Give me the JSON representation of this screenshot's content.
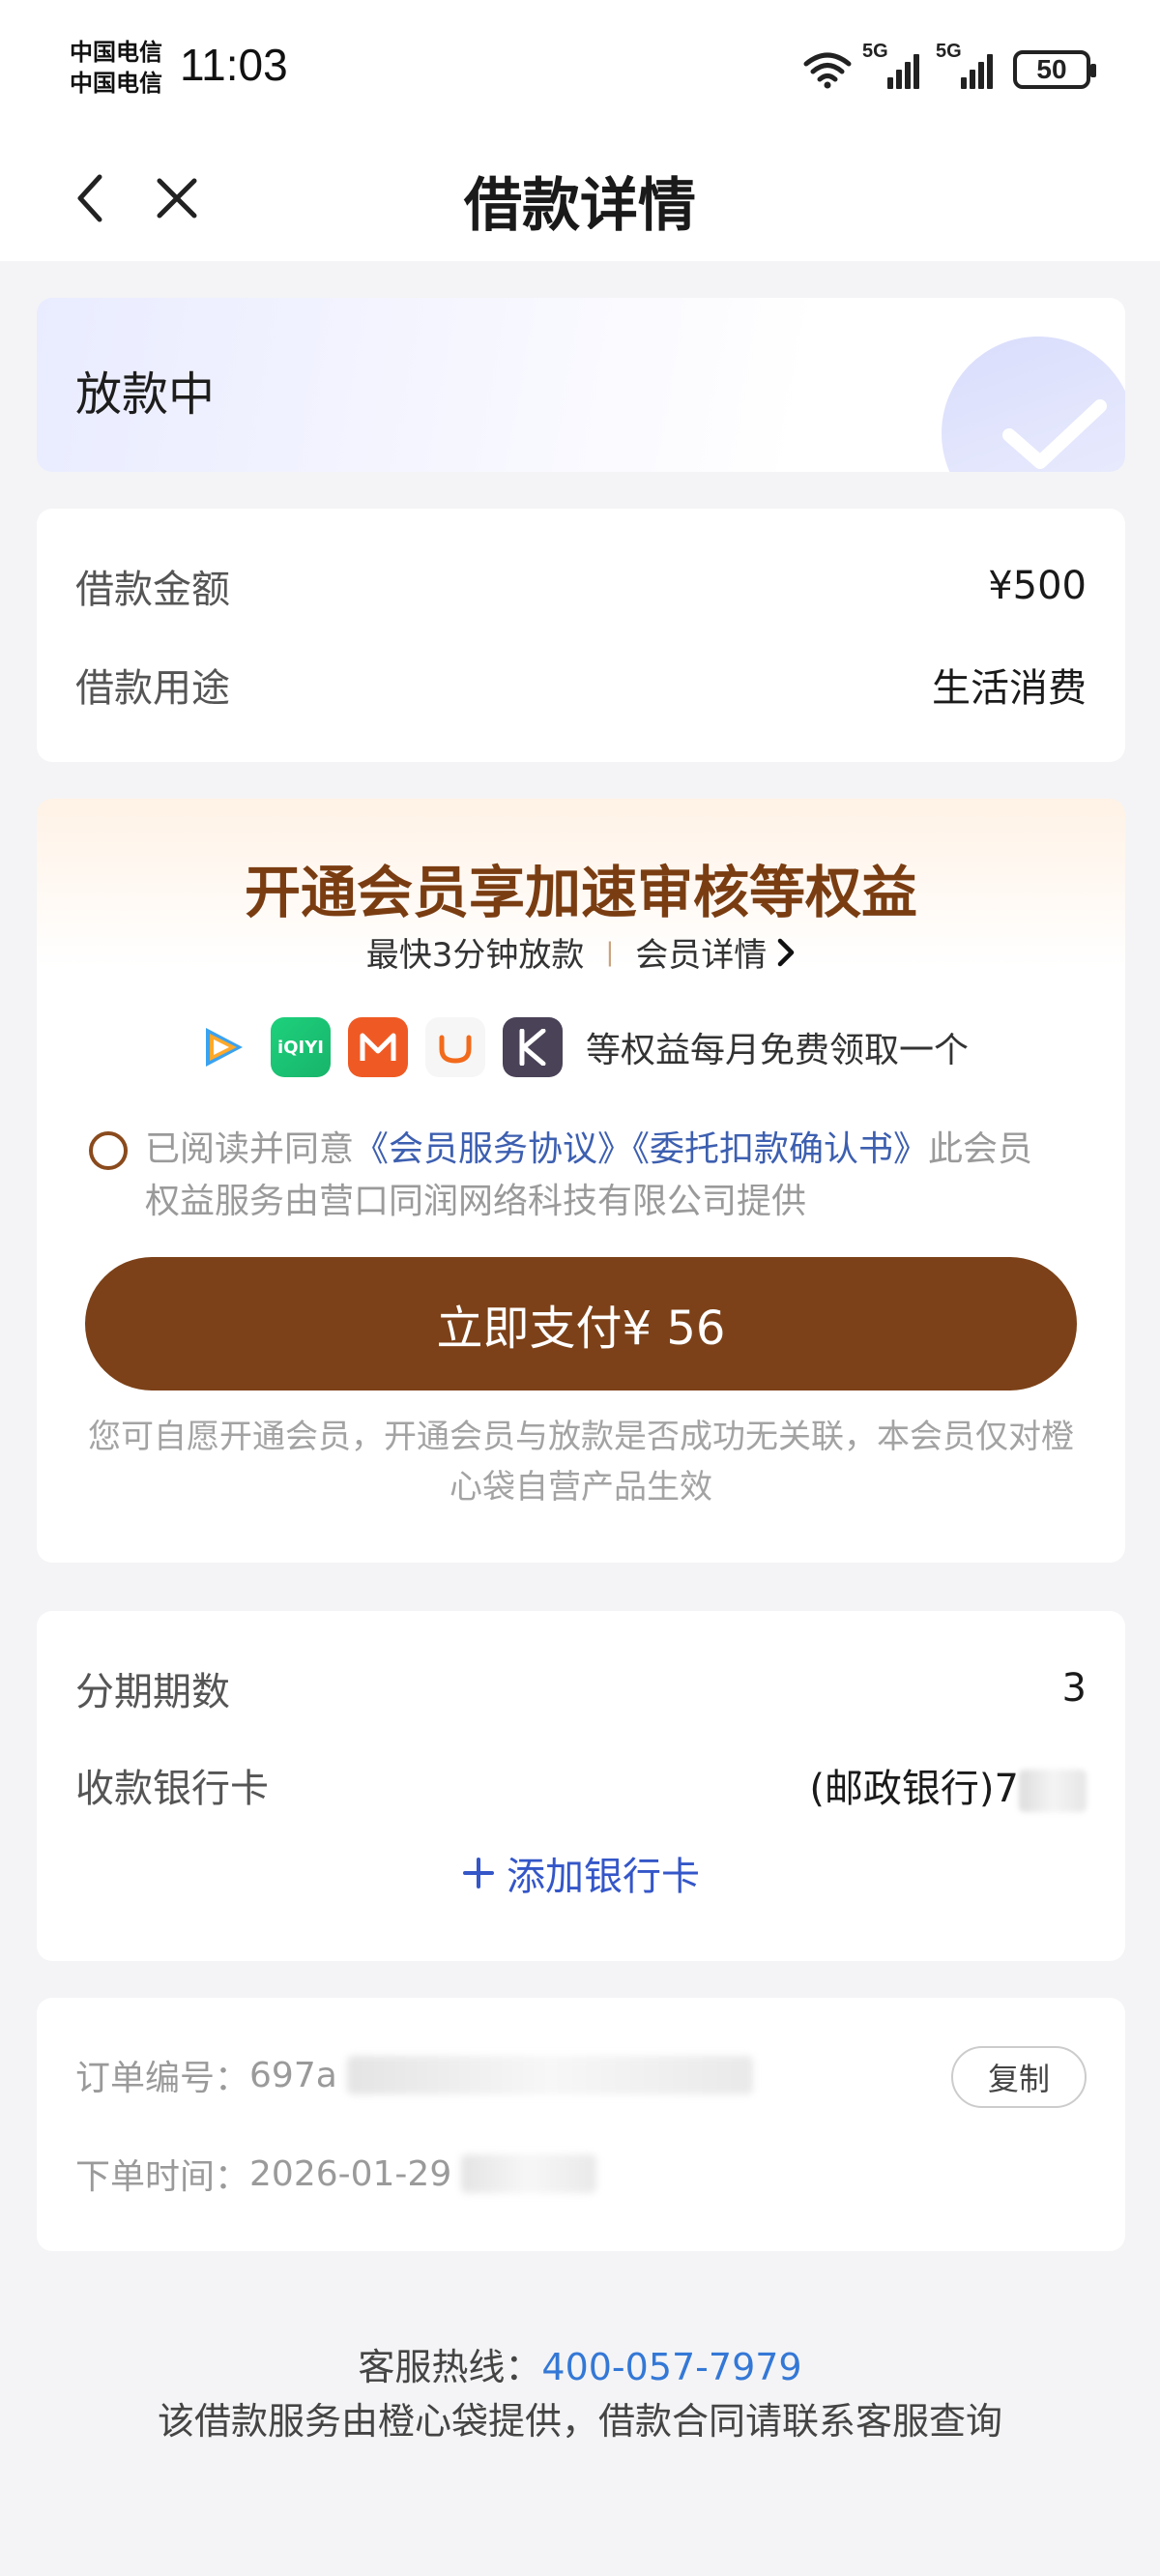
{
  "status_bar": {
    "carrier_1": "中国电信",
    "carrier_2": "中国电信",
    "time": "11:03",
    "network_1": "5G",
    "network_2": "5G",
    "battery": "50"
  },
  "header": {
    "title": "借款详情",
    "back_icon": "chevron-left-icon",
    "close_icon": "close-icon"
  },
  "status": {
    "text": "放款中",
    "icon": "check-icon"
  },
  "loan_info": {
    "amount_label": "借款金额",
    "amount_value": "¥500",
    "purpose_label": "借款用途",
    "purpose_value": "生活消费"
  },
  "membership": {
    "title": "开通会员享加速审核等权益",
    "speed_text": "最快3分钟放款",
    "separator": "|",
    "detail_link": "会员详情",
    "apps": [
      "tencent-video",
      "iqiyi",
      "mango-tv",
      "didi",
      "keep"
    ],
    "apps_text": "等权益每月免费领取一个",
    "agree_prefix": "已阅读并同意",
    "agree_link_1": "《会员服务协议》",
    "agree_link_2": "《委托扣款确认书》",
    "agree_suffix": "此会员权益服务由营口同润网络科技有限公司提供",
    "pay_button": "立即支付¥ 56",
    "note": "您可自愿开通会员，开通会员与放款是否成功无关联，本会员仅对橙心袋自营产品生效",
    "colors": {
      "accent": "#7c4118",
      "link": "#3d5fb0"
    }
  },
  "loan_detail": {
    "installments_label": "分期期数",
    "installments_value": "3",
    "bank_label": "收款银行卡",
    "bank_value": "(邮政银行)7",
    "add_card": "添加银行卡"
  },
  "order": {
    "id_label": "订单编号：",
    "id_value": "697a",
    "copy_button": "复制",
    "time_label": "下单时间：",
    "time_value": "2026-01-29"
  },
  "footer": {
    "hotline_label": "客服热线：",
    "hotline_number": "400-057-7979",
    "notice": "该借款服务由橙心袋提供，借款合同请联系客服查询"
  }
}
